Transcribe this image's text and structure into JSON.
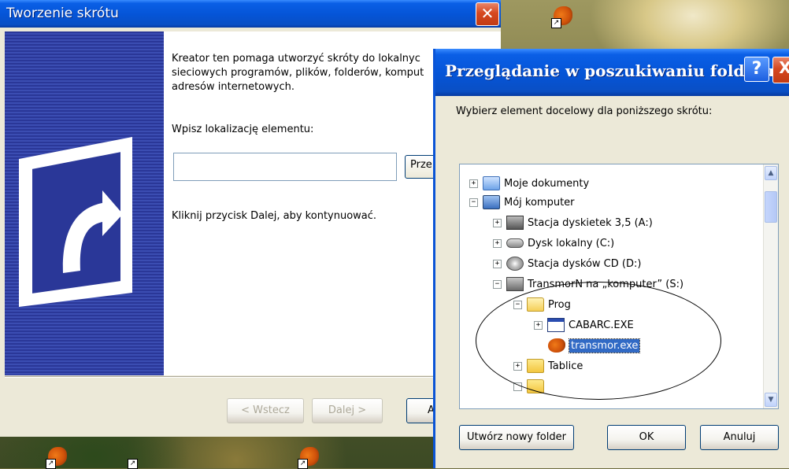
{
  "wizard": {
    "title": "Tworzenie skrótu",
    "intro": "Kreator ten pomaga utworzyć skróty do lokalnyc",
    "intro_line2": "sieciowych programów, plików, folderów, komput",
    "intro_line3": "adresów internetowych.",
    "location_label": "Wpisz lokalizację elementu:",
    "location_value": "",
    "browse_label": "Prze",
    "continue_text": "Kliknij przycisk Dalej, aby kontynuować.",
    "back_label": "< Wstecz",
    "next_label": "Dalej >",
    "cancel_label": "A"
  },
  "dialog": {
    "title": "Przeglądanie w poszukiwaniu folderu",
    "help_label": "?",
    "close_label": "X",
    "prompt": "Wybierz element docelowy dla poniższego skrótu:",
    "tree": [
      {
        "label": "Moje dokumenty",
        "expander": "+",
        "icon": "documents-icon"
      },
      {
        "label": "Mój komputer",
        "expander": "−",
        "icon": "computer-icon"
      },
      {
        "label": "Stacja dyskietek 3,5 (A:)",
        "expander": "+",
        "icon": "floppy-drive-icon"
      },
      {
        "label": "Dysk lokalny (C:)",
        "expander": "+",
        "icon": "hard-disk-icon"
      },
      {
        "label": "Stacja dysków CD (D:)",
        "expander": "+",
        "icon": "cd-drive-icon"
      },
      {
        "label": "TransmorN na „komputer” (S:)",
        "expander": "−",
        "icon": "network-drive-icon"
      },
      {
        "label": "Prog",
        "expander": "−",
        "icon": "open-folder-icon"
      },
      {
        "label": "CABARC.EXE",
        "expander": "+",
        "icon": "exe-window-icon"
      },
      {
        "label": "transmor.exe",
        "expander": "",
        "icon": "fox-app-icon",
        "selected": true
      },
      {
        "label": "Tablice",
        "expander": "+",
        "icon": "folder-icon"
      }
    ],
    "new_folder_label": "Utwórz nowy folder",
    "ok_label": "OK",
    "cancel_label": "Anuluj"
  },
  "colors": {
    "title_bar": "#0554d6",
    "close_button": "#d6481f",
    "selection": "#316ac5",
    "window_bg": "#ece9d8"
  }
}
